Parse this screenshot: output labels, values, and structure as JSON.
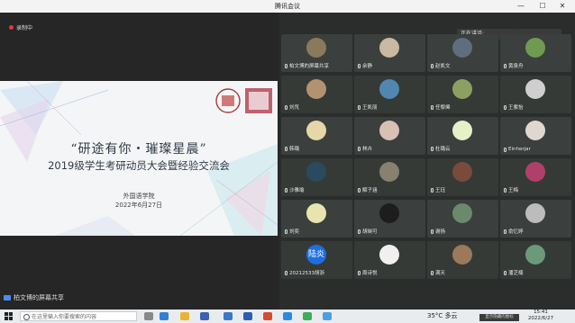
{
  "window": {
    "title": "腾讯会议",
    "min": "—",
    "max": "☐",
    "close": "✕"
  },
  "recording": {
    "label": "录制中"
  },
  "slide": {
    "logo_text": "上海外国语大学",
    "title": "“研途有你・璀璨星晨”",
    "subtitle": "2019级学生考研动员大会暨经验交流会",
    "org": "外国语学院",
    "date": "2022年6月27日"
  },
  "share": {
    "label": "柏文博的屏幕共享"
  },
  "speaking": {
    "label": "正在讲话:"
  },
  "participants": [
    {
      "name": "柏文博的屏幕共享",
      "color": "#8a7a5a",
      "share": true
    },
    {
      "name": "余静",
      "color": "#c9b9a0"
    },
    {
      "name": "赵凯文",
      "color": "#5e6e7e"
    },
    {
      "name": "黄泉舟",
      "color": "#6f9a52"
    },
    {
      "name": "刘氘",
      "color": "#b39270"
    },
    {
      "name": "王凯丽",
      "color": "#4f87b0"
    },
    {
      "name": "任黎烯",
      "color": "#8ca062"
    },
    {
      "name": "王紫怡",
      "color": "#cfcfcf"
    },
    {
      "name": "韩璐",
      "color": "#e6d7a8"
    },
    {
      "name": "林卉",
      "color": "#d9c0b4"
    },
    {
      "name": "杜璐云",
      "color": "#e8f0c8"
    },
    {
      "name": "Einherjar",
      "color": "#e0d8d0"
    },
    {
      "name": "沙雅瑜",
      "color": "#2a4a60"
    },
    {
      "name": "解子涵",
      "color": "#8a8070"
    },
    {
      "name": "王珏",
      "color": "#7a4a3a"
    },
    {
      "name": "王梅",
      "color": "#b0406a"
    },
    {
      "name": "刘奕",
      "color": "#e8e4b0"
    },
    {
      "name": "胡映可",
      "color": "#1d1d1d"
    },
    {
      "name": "谢扬",
      "color": "#6a8a6a"
    },
    {
      "name": "俞忆婷",
      "color": "#bcbcbc"
    },
    {
      "name": "20212533胡浙",
      "color": "#1e6ee0",
      "text": "陆炎"
    },
    {
      "name": "周诗悦",
      "color": "#f0f0f0"
    },
    {
      "name": "满天",
      "color": "#9a7a5a"
    },
    {
      "name": "潘芝楠",
      "color": "#6a9a7a"
    }
  ],
  "taskbar": {
    "search_placeholder": "在这里输入你要搜索的内容",
    "weather": "35°C 多云",
    "tray_label": "显示隐藏的图标",
    "time": "15:41",
    "date": "2022/6/27"
  }
}
